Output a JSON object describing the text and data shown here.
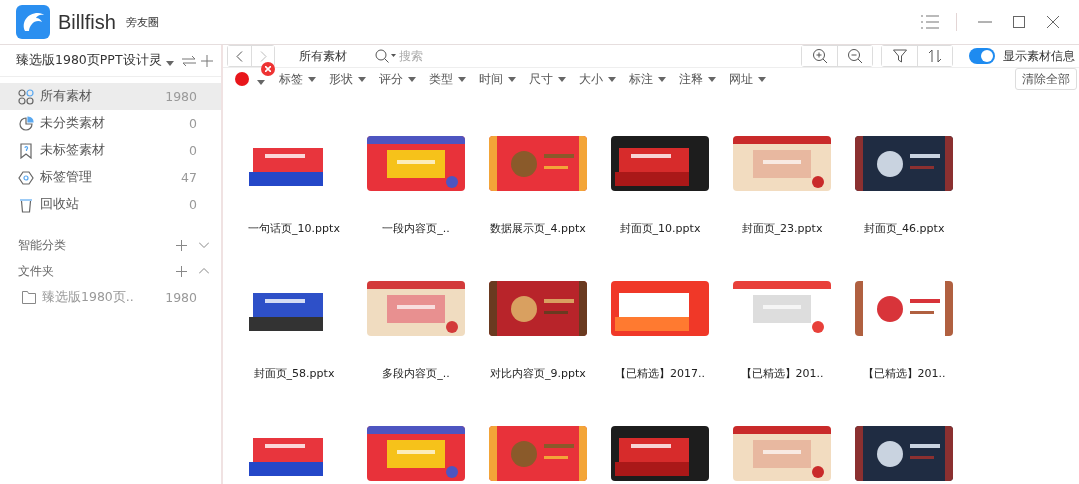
{
  "app": {
    "name": "Billfish",
    "user": "旁友圈"
  },
  "library": {
    "name": "臻选版1980页PPT设计灵"
  },
  "sidebar": {
    "items": [
      {
        "kind": "all",
        "label": "所有素材",
        "count": "1980",
        "selected": true
      },
      {
        "kind": "unsorted",
        "label": "未分类素材",
        "count": "0",
        "selected": false
      },
      {
        "kind": "untagged",
        "label": "未标签素材",
        "count": "0",
        "selected": false
      },
      {
        "kind": "tags",
        "label": "标签管理",
        "count": "47",
        "selected": false
      },
      {
        "kind": "trash",
        "label": "回收站",
        "count": "0",
        "selected": false
      }
    ],
    "sections": [
      {
        "title": "智能分类",
        "expanded": false
      },
      {
        "title": "文件夹",
        "expanded": true,
        "children": [
          {
            "label": "臻选版1980页..",
            "count": "1980"
          }
        ]
      }
    ]
  },
  "toolbar": {
    "breadcrumb": "所有素材",
    "search": {
      "placeholder": "搜索"
    },
    "show_info": {
      "label": "显示素材信息",
      "on": true
    }
  },
  "filters": {
    "color": {
      "color": "#e8161b"
    },
    "items": [
      "标签",
      "形状",
      "评分",
      "类型",
      "时间",
      "尺寸",
      "大小",
      "标注",
      "注释",
      "网址"
    ],
    "clear": "清除全部"
  },
  "files": [
    {
      "kind": "file",
      "name": "一句话页_10.pptx"
    },
    {
      "kind": "file",
      "name": "一段内容页_.."
    },
    {
      "kind": "file",
      "name": "数据展示页_4.pptx"
    },
    {
      "kind": "file",
      "name": "封面页_10.pptx"
    },
    {
      "kind": "file",
      "name": "封面页_23.pptx"
    },
    {
      "kind": "file",
      "name": "封面页_46.pptx"
    },
    {
      "kind": "file",
      "name": "封面页_58.pptx"
    },
    {
      "kind": "file",
      "name": "多段内容页_.."
    },
    {
      "kind": "file",
      "name": "对比内容页_9.pptx"
    },
    {
      "kind": "file",
      "name": "【已精选】2017.."
    },
    {
      "kind": "file",
      "name": "【已精选】201.."
    },
    {
      "kind": "file",
      "name": "【已精选】201.."
    },
    {
      "kind": "picture"
    },
    {
      "kind": "picture"
    },
    {
      "kind": "picture"
    },
    {
      "kind": "picture"
    },
    {
      "kind": "picture"
    },
    {
      "kind": "picture"
    }
  ]
}
